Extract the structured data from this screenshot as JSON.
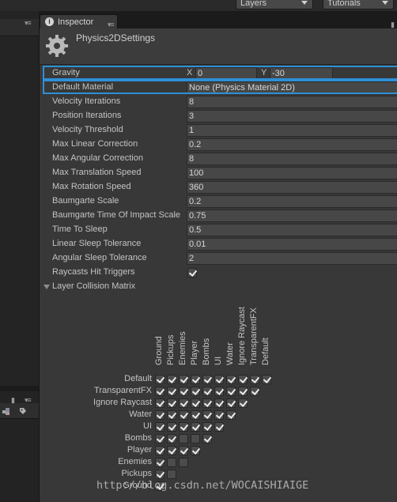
{
  "toolbar": {
    "layers_label": "Layers",
    "tutorials_label": "Tutorials"
  },
  "inspector": {
    "tab_label": "Inspector",
    "tab_icon": "info-icon",
    "title": "Physics2DSettings",
    "title_icon": "gear-icon",
    "panel_menu_icon": "panel-menu-icon",
    "lock_icon": "lock-icon",
    "highlight_color": "#2f8fd6",
    "gravity": {
      "label": "Gravity",
      "x_label": "X",
      "x_value": "0",
      "y_label": "Y",
      "y_value": "-30"
    },
    "properties": [
      {
        "label": "Default Material",
        "value": "None (Physics Material 2D)"
      },
      {
        "label": "Velocity Iterations",
        "value": "8"
      },
      {
        "label": "Position Iterations",
        "value": "3"
      },
      {
        "label": "Velocity Threshold",
        "value": "1"
      },
      {
        "label": "Max Linear Correction",
        "value": "0.2"
      },
      {
        "label": "Max Angular Correction",
        "value": "8"
      },
      {
        "label": "Max Translation Speed",
        "value": "100"
      },
      {
        "label": "Max Rotation Speed",
        "value": "360"
      },
      {
        "label": "Baumgarte Scale",
        "value": "0.2"
      },
      {
        "label": "Baumgarte Time Of Impact Scale",
        "value": "0.75"
      },
      {
        "label": "Time To Sleep",
        "value": "0.5"
      },
      {
        "label": "Linear Sleep Tolerance",
        "value": "0.01"
      },
      {
        "label": "Angular Sleep Tolerance",
        "value": "2"
      }
    ],
    "raycasts_hit_triggers": {
      "label": "Raycasts Hit Triggers",
      "checked": true
    },
    "layer_collision_matrix": {
      "label": "Layer Collision Matrix",
      "columns": [
        "Ground",
        "Pickups",
        "Enemies",
        "Player",
        "Bombs",
        "UI",
        "Water",
        "Ignore Raycast",
        "TransparentFX",
        "Default"
      ],
      "rows": [
        {
          "label": "Default",
          "checks": [
            true,
            true,
            true,
            true,
            true,
            true,
            true,
            true,
            true,
            true
          ]
        },
        {
          "label": "TransparentFX",
          "checks": [
            true,
            true,
            true,
            true,
            true,
            true,
            true,
            true,
            true
          ]
        },
        {
          "label": "Ignore Raycast",
          "checks": [
            true,
            true,
            true,
            true,
            true,
            true,
            true,
            true
          ]
        },
        {
          "label": "Water",
          "checks": [
            true,
            true,
            true,
            true,
            true,
            true,
            true
          ]
        },
        {
          "label": "UI",
          "checks": [
            true,
            true,
            true,
            true,
            true,
            true
          ]
        },
        {
          "label": "Bombs",
          "checks": [
            true,
            true,
            false,
            false,
            true
          ]
        },
        {
          "label": "Player",
          "checks": [
            true,
            true,
            true,
            true
          ]
        },
        {
          "label": "Enemies",
          "checks": [
            true,
            false,
            false
          ]
        },
        {
          "label": "Pickups",
          "checks": [
            true,
            false
          ]
        },
        {
          "label": "Ground",
          "checks": [
            true
          ]
        }
      ]
    }
  },
  "watermark": "http://blog.csdn.net/WOCAISHIAIGE"
}
